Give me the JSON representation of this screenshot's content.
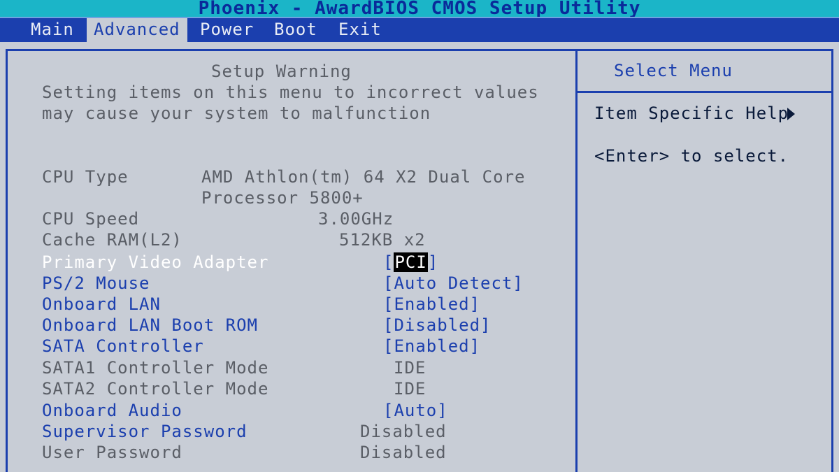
{
  "title": "Phoenix - AwardBIOS CMOS Setup Utility",
  "menu": {
    "items": [
      "Main",
      "Advanced",
      "Power",
      "Boot",
      "Exit"
    ],
    "active": "Advanced"
  },
  "warning": {
    "heading": "Setup Warning",
    "line1": "Setting items on this menu to incorrect values",
    "line2": "may cause your system to malfunction"
  },
  "info": {
    "cpu_type_label": "CPU Type",
    "cpu_type_value_line1": "AMD Athlon(tm) 64 X2 Dual Core",
    "cpu_type_value_line2": "Processor 5800+",
    "cpu_speed_label": "CPU Speed",
    "cpu_speed_value": "3.00GHz",
    "cache_label": "Cache RAM(L2)",
    "cache_value": "512KB x2"
  },
  "settings": [
    {
      "label": "Primary Video Adapter",
      "value": "[PCI]",
      "selected": true
    },
    {
      "label": "PS/2 Mouse",
      "value": "[Auto Detect]"
    },
    {
      "label": "Onboard LAN",
      "value": "[Enabled]"
    },
    {
      "label": "Onboard LAN Boot ROM",
      "value": "[Disabled]"
    },
    {
      "label": "SATA Controller",
      "value": "[Enabled]"
    },
    {
      "label": "SATA1 Controller Mode",
      "value": "IDE"
    },
    {
      "label": "SATA2 Controller Mode",
      "value": "IDE"
    },
    {
      "label": "Onboard Audio",
      "value": "[Auto]"
    },
    {
      "label": "Supervisor Password",
      "value": "Disabled"
    },
    {
      "label": "User Password",
      "value": "Disabled"
    }
  ],
  "pci_inner": "PCI",
  "help": {
    "header": "Select Menu",
    "title": "Item Specific Help",
    "line": "<Enter> to select."
  },
  "colors": {
    "title_bar": "#1bb5c8",
    "menu_bar": "#1b3fae",
    "background": "#c8cdd6",
    "selected_item": "#ffffff",
    "editable_item": "#1b3fae",
    "readonly_item": "#5a5e66"
  }
}
